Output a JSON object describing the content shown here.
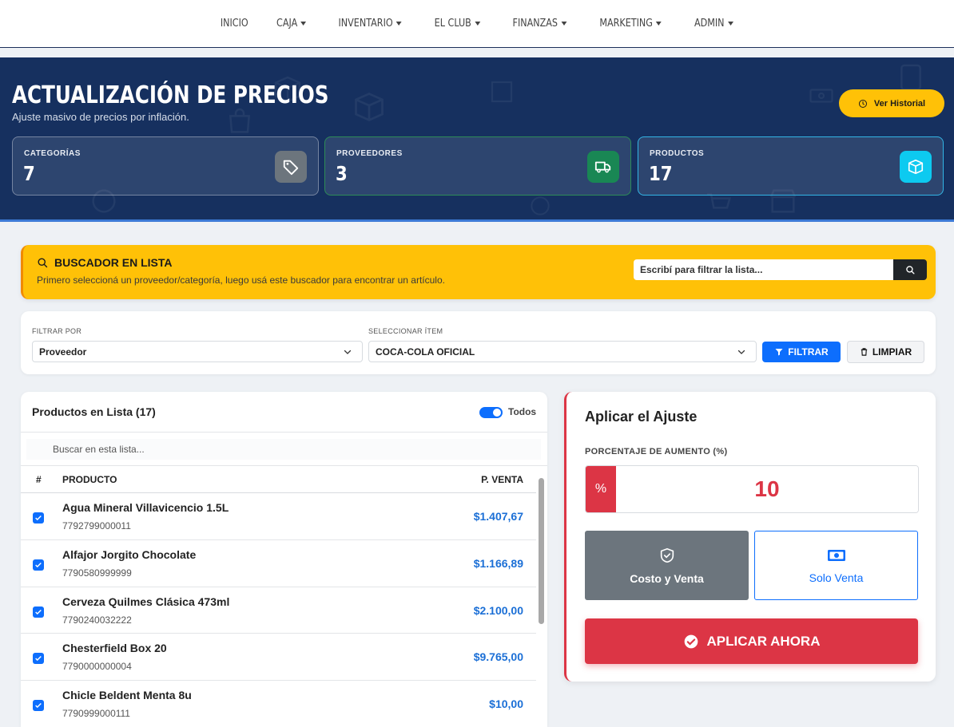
{
  "nav": {
    "items": [
      {
        "label": "INICIO",
        "caret": false
      },
      {
        "label": "CAJA",
        "caret": true
      },
      {
        "label": "INVENTARIO",
        "caret": true
      },
      {
        "label": "EL CLUB",
        "caret": true
      },
      {
        "label": "FINANZAS",
        "caret": true
      },
      {
        "label": "MARKETING",
        "caret": true
      },
      {
        "label": "ADMIN",
        "caret": true
      }
    ]
  },
  "hero": {
    "title": "ACTUALIZACIÓN DE PRECIOS",
    "subtitle": "Ajuste masivo de precios por inflación.",
    "history_button": "Ver Historial",
    "stats": [
      {
        "label": "CATEGORÍAS",
        "value": "7",
        "icon": "tag-icon",
        "color": "#6c757d"
      },
      {
        "label": "PROVEEDORES",
        "value": "3",
        "icon": "truck-icon",
        "color": "#198754"
      },
      {
        "label": "PRODUCTOS",
        "value": "17",
        "icon": "box-icon",
        "color": "#0dcaf0"
      }
    ]
  },
  "search_banner": {
    "title": "BUSCADOR EN LISTA",
    "description": "Primero seleccioná un proveedor/categoría, luego usá este buscador para encontrar un artículo.",
    "placeholder": "Escribí para filtrar la lista..."
  },
  "filter": {
    "filter_by_label": "FILTRAR POR",
    "filter_by_value": "Proveedor",
    "item_label": "SELECCIONAR ÍTEM",
    "item_value": "COCA-COLA OFICIAL",
    "filter_button": "FILTRAR",
    "clear_button": "LIMPIAR"
  },
  "products": {
    "title": "Productos en Lista (17)",
    "toggle_label": "Todos",
    "search_placeholder": "Buscar en esta lista...",
    "columns": {
      "index": "#",
      "product": "PRODUCTO",
      "price": "P. VENTA"
    },
    "rows": [
      {
        "name": "Agua Mineral Villavicencio 1.5L",
        "code": "7792799000011",
        "price": "$1.407,67"
      },
      {
        "name": "Alfajor Jorgito Chocolate",
        "code": "7790580999999",
        "price": "$1.166,89"
      },
      {
        "name": "Cerveza Quilmes Clásica 473ml",
        "code": "7790240032222",
        "price": "$2.100,00"
      },
      {
        "name": "Chesterfield Box 20",
        "code": "7790000000004",
        "price": "$9.765,00"
      },
      {
        "name": "Chicle Beldent Menta 8u",
        "code": "7790999000111",
        "price": "$10,00"
      }
    ]
  },
  "adjust": {
    "title": "Aplicar el Ajuste",
    "percent_label": "PORCENTAJE DE AUMENTO (%)",
    "percent_symbol": "%",
    "percent_value": "10",
    "option_a": "Costo y Venta",
    "option_b": "Solo Venta",
    "apply_button": "APLICAR AHORA"
  }
}
